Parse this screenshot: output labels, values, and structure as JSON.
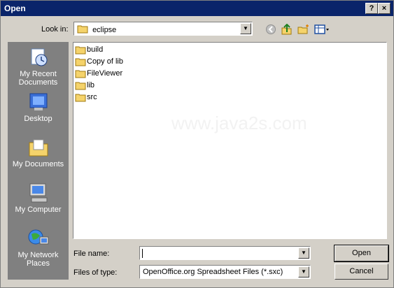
{
  "window": {
    "title": "Open",
    "help_label": "?",
    "close_label": "×"
  },
  "lookin": {
    "label": "Look in:",
    "value": "eclipse"
  },
  "toolbar_icons": [
    "back-icon",
    "up-folder-icon",
    "new-folder-icon",
    "view-menu-icon"
  ],
  "places": [
    {
      "label1": "My Recent",
      "label2": "Documents",
      "icon": "recent-documents-icon"
    },
    {
      "label1": "Desktop",
      "label2": "",
      "icon": "desktop-icon"
    },
    {
      "label1": "My Documents",
      "label2": "",
      "icon": "my-documents-icon"
    },
    {
      "label1": "My Computer",
      "label2": "",
      "icon": "my-computer-icon"
    },
    {
      "label1": "My Network",
      "label2": "Places",
      "icon": "my-network-icon"
    }
  ],
  "files": [
    "build",
    "Copy of lib",
    "FileViewer",
    "lib",
    "src"
  ],
  "watermark": "www.java2s.com",
  "filename": {
    "label": "File name:",
    "value": ""
  },
  "filetype": {
    "label": "Files of type:",
    "value": "OpenOffice.org Spreadsheet Files (*.sxc)"
  },
  "buttons": {
    "open": "Open",
    "cancel": "Cancel"
  },
  "colors": {
    "titlebar": "#0a246a",
    "dialog_bg": "#d4d0c8",
    "places_bg": "#808080",
    "folder": "#f5d36b"
  }
}
